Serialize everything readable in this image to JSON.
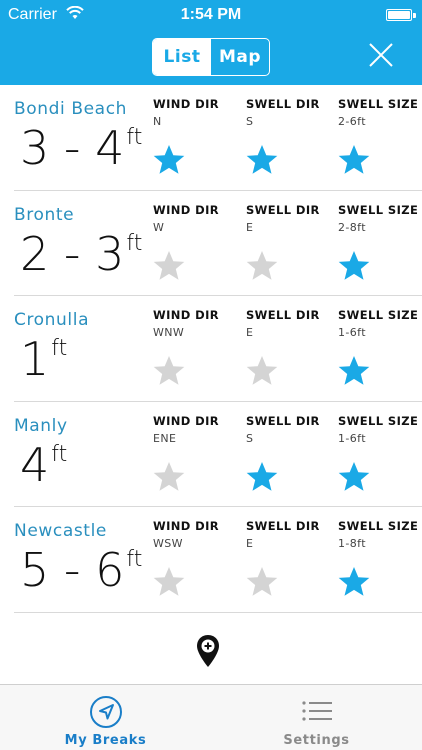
{
  "status_bar": {
    "carrier": "Carrier",
    "time": "1:54 PM"
  },
  "header": {
    "segments": [
      {
        "label": "List",
        "active": true
      },
      {
        "label": "Map",
        "active": false
      }
    ]
  },
  "columns": {
    "wind_dir": "WIND DIR",
    "swell_dir": "SWELL DIR",
    "swell_size": "SWELL SIZE"
  },
  "breaks": [
    {
      "name": "Bondi Beach",
      "size": "3 - 4",
      "unit": "ft",
      "wind_dir": "N",
      "swell_dir": "S",
      "swell_size": "2-6ft",
      "stars": [
        true,
        true,
        true
      ]
    },
    {
      "name": "Bronte",
      "size": "2 - 3",
      "unit": "ft",
      "wind_dir": "W",
      "swell_dir": "E",
      "swell_size": "2-8ft",
      "stars": [
        false,
        false,
        true
      ]
    },
    {
      "name": "Cronulla",
      "size": "1",
      "unit": "ft",
      "wind_dir": "WNW",
      "swell_dir": "E",
      "swell_size": "1-6ft",
      "stars": [
        false,
        false,
        true
      ]
    },
    {
      "name": "Manly",
      "size": "4",
      "unit": "ft",
      "wind_dir": "ENE",
      "swell_dir": "S",
      "swell_size": "1-6ft",
      "stars": [
        false,
        true,
        true
      ]
    },
    {
      "name": "Newcastle",
      "size": "5 - 6",
      "unit": "ft",
      "wind_dir": "WSW",
      "swell_dir": "E",
      "swell_size": "1-8ft",
      "stars": [
        false,
        false,
        true
      ]
    }
  ],
  "tabs": [
    {
      "label": "My Breaks",
      "active": true,
      "icon": "location-arrow-icon"
    },
    {
      "label": "Settings",
      "active": false,
      "icon": "list-icon"
    }
  ],
  "colors": {
    "accent": "#1aa9e6",
    "star_on": "#1aa9e6",
    "star_off": "#d4d4d4",
    "name": "#2a8fbe"
  }
}
